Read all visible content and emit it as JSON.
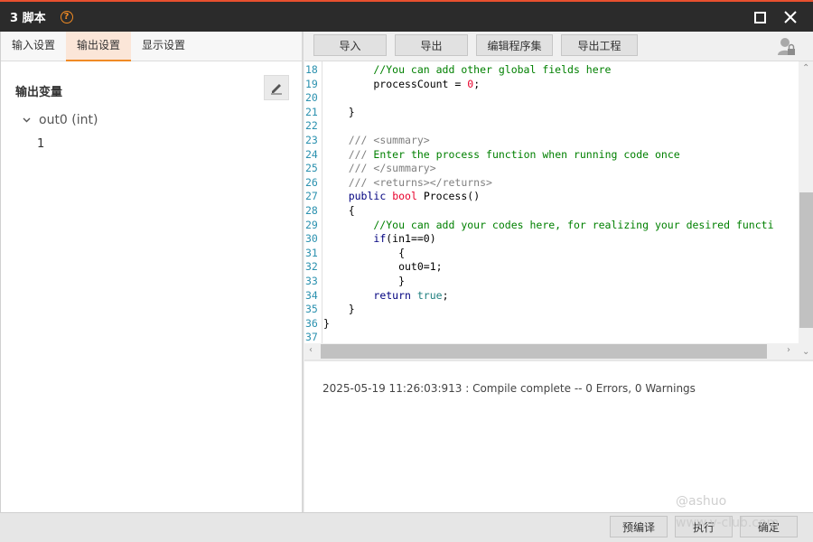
{
  "window": {
    "title": "3 脚本",
    "help_icon": "question-circle-icon",
    "maximize_icon": "maximize-icon",
    "close_icon": "close-icon"
  },
  "left": {
    "tabs": [
      "输入设置",
      "输出设置",
      "显示设置"
    ],
    "active_tab": "输出设置",
    "section_title": "输出变量",
    "edit_icon": "pencil-icon",
    "tree": {
      "node_label": "out0 (int)",
      "value": "1"
    }
  },
  "toolbar": {
    "import": "导入",
    "export": "导出",
    "edit_assembly": "编辑程序集",
    "export_project": "导出工程",
    "user_icon": "user-lock-icon"
  },
  "editor": {
    "lines": [
      {
        "n": "18",
        "t": "        //You can add other global fields here"
      },
      {
        "n": "19",
        "t": "        processCount = 0;"
      },
      {
        "n": "20",
        "t": ""
      },
      {
        "n": "21",
        "t": "    }"
      },
      {
        "n": "22",
        "t": ""
      },
      {
        "n": "23",
        "t": "    /// <summary>"
      },
      {
        "n": "24",
        "t": "    /// Enter the process function when running code once"
      },
      {
        "n": "25",
        "t": "    /// </summary>"
      },
      {
        "n": "26",
        "t": "    /// <returns></returns>"
      },
      {
        "n": "27",
        "t": "    public bool Process()"
      },
      {
        "n": "28",
        "t": "    {"
      },
      {
        "n": "29",
        "t": "        //You can add your codes here, for realizing your desired functi"
      },
      {
        "n": "30",
        "t": "        if(in1==0)"
      },
      {
        "n": "31",
        "t": "            {"
      },
      {
        "n": "32",
        "t": "            out0=1;"
      },
      {
        "n": "33",
        "t": "            }"
      },
      {
        "n": "34",
        "t": "        return true;"
      },
      {
        "n": "35",
        "t": "    }"
      },
      {
        "n": "36",
        "t": "}"
      },
      {
        "n": "37",
        "t": ""
      }
    ]
  },
  "output": {
    "message": "2025-05-19 11:26:03:913 : Compile complete -- 0 Errors, 0 Warnings"
  },
  "bottom": {
    "precompile": "预编译",
    "run": "执行",
    "confirm": "确定"
  },
  "watermark": {
    "line1": "@ashuo",
    "line2": "www.v-club.com"
  },
  "colors": {
    "accent": "#f08a24",
    "titlebar": "#2b2b2b",
    "comment": "#008000",
    "keyword": "#0000ff"
  }
}
